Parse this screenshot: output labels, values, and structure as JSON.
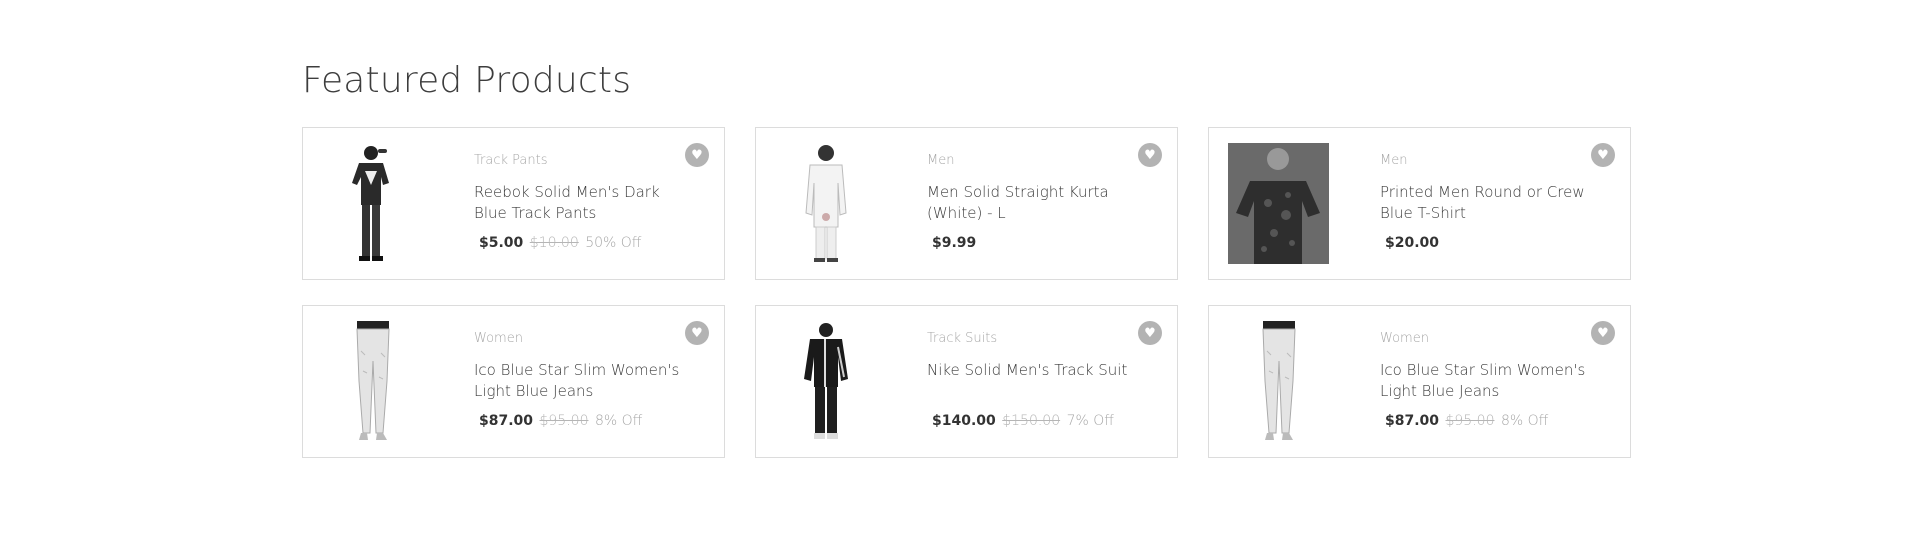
{
  "section": {
    "title": "Featured Products"
  },
  "products": [
    {
      "category": "Track Pants",
      "title": "Reebok Solid Men's Dark Blue Track Pants",
      "price": "$5.00",
      "old_price": "$10.00",
      "discount": "50% Off",
      "figure": "man-tshirt",
      "framed": false
    },
    {
      "category": "Men",
      "title": "Men Solid Straight Kurta (White) - L",
      "price": "$9.99",
      "old_price": "",
      "discount": "",
      "figure": "man-kurta",
      "framed": false
    },
    {
      "category": "Men",
      "title": "Printed Men Round or Crew Blue T-Shirt",
      "price": "$20.00",
      "old_price": "",
      "discount": "",
      "figure": "man-printed-tee",
      "framed": true
    },
    {
      "category": "Women",
      "title": "Ico Blue Star Slim Women's Light Blue Jeans",
      "price": "$87.00",
      "old_price": "$95.00",
      "discount": "8% Off",
      "figure": "woman-jeans",
      "framed": false
    },
    {
      "category": "Track Suits",
      "title": "Nike Solid Men's Track Suit",
      "price": "$140.00",
      "old_price": "$150.00",
      "discount": "7% Off",
      "figure": "man-tracksuit",
      "framed": false
    },
    {
      "category": "Women",
      "title": "Ico Blue Star Slim Women's Light Blue Jeans",
      "price": "$87.00",
      "old_price": "$95.00",
      "discount": "8% Off",
      "figure": "woman-jeans",
      "framed": false
    }
  ],
  "icons": {
    "wishlist": "heart-icon"
  }
}
